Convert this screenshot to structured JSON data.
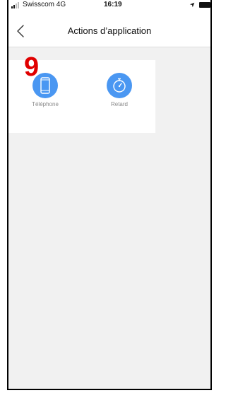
{
  "status_bar": {
    "carrier": "Swisscom  4G",
    "time": "16:19"
  },
  "nav": {
    "title": "Actions d’application"
  },
  "overlay": {
    "step_number": "9"
  },
  "actions": {
    "items": [
      {
        "label": "Téléphone",
        "icon": "phone-icon"
      },
      {
        "label": "Retard",
        "icon": "timer-icon"
      }
    ]
  },
  "colors": {
    "accent": "#4a97f2",
    "background": "#f1f1f1",
    "step_number": "#e00000"
  }
}
